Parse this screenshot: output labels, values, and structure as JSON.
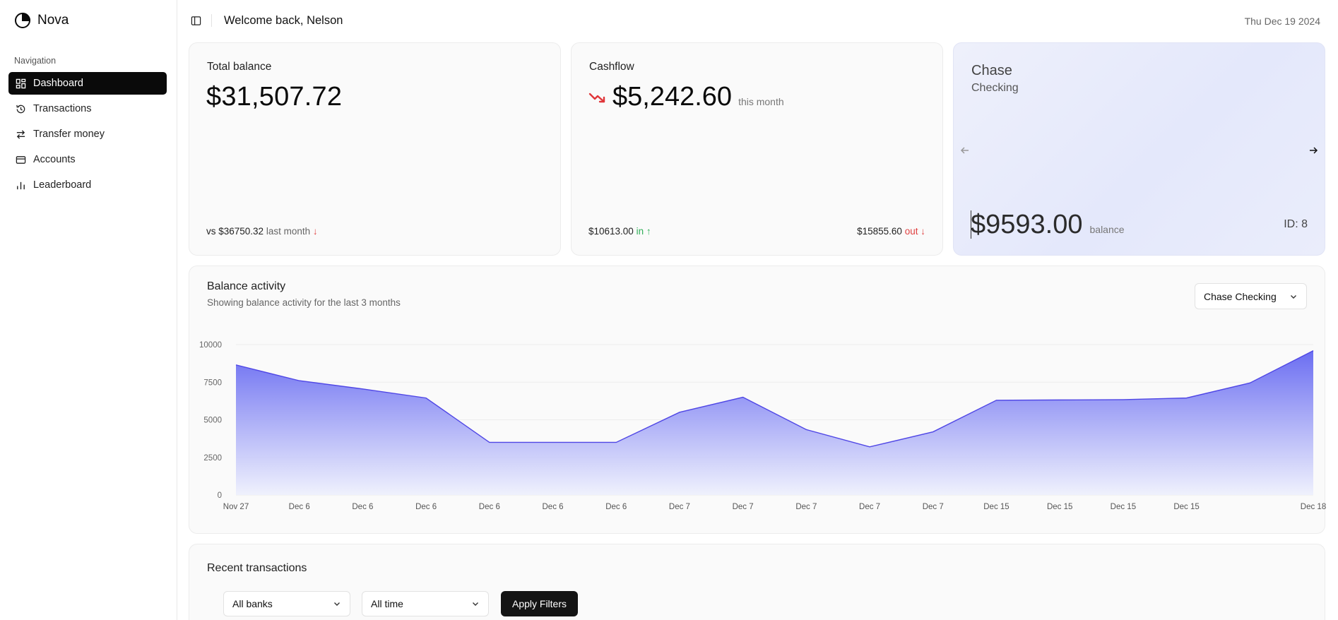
{
  "brand": {
    "name": "Nova",
    "icon": "pie-chart-icon"
  },
  "sidebar": {
    "heading": "Navigation",
    "items": [
      {
        "label": "Dashboard",
        "icon": "grid-icon",
        "active": true
      },
      {
        "label": "Transactions",
        "icon": "history-icon",
        "active": false
      },
      {
        "label": "Transfer money",
        "icon": "swap-arrows-icon",
        "active": false
      },
      {
        "label": "Accounts",
        "icon": "credit-card-icon",
        "active": false
      },
      {
        "label": "Leaderboard",
        "icon": "bar-chart-icon",
        "active": false
      }
    ]
  },
  "header": {
    "welcome": "Welcome back, Nelson",
    "date": "Thu Dec 19 2024"
  },
  "total_balance": {
    "label": "Total balance",
    "value": "$31,507.72",
    "compare_amount": "vs $36750.32",
    "compare_text": "last month",
    "trend": "↓"
  },
  "cashflow": {
    "label": "Cashflow",
    "value": "$5,242.60",
    "period": "this month",
    "in_amount": "$10613.00",
    "in_label": "in ↑",
    "out_amount": "$15855.60",
    "out_label": "out ↓"
  },
  "account_card": {
    "bank": "Chase",
    "type": "Checking",
    "balance": "$9593.00",
    "balance_label": "balance",
    "id_text": "ID: 8"
  },
  "balance_activity": {
    "title": "Balance activity",
    "subtitle": "Showing balance activity for the last 3 months",
    "account_select": "Chase Checking"
  },
  "chart_data": {
    "type": "area",
    "title": "Balance activity",
    "x": [
      "Nov 27",
      "Dec 6",
      "Dec 6",
      "Dec 6",
      "Dec 6",
      "Dec 6",
      "Dec 6",
      "Dec 7",
      "Dec 7",
      "Dec 7",
      "Dec 7",
      "Dec 7",
      "Dec 15",
      "Dec 15",
      "Dec 15",
      "Dec 15",
      "",
      "Dec 18"
    ],
    "values": [
      8650,
      7600,
      7050,
      6450,
      3500,
      3500,
      3500,
      5500,
      6500,
      4350,
      3200,
      4200,
      6300,
      6320,
      6340,
      6450,
      7450,
      9593
    ],
    "yticks": [
      0,
      2500,
      5000,
      7500,
      10000
    ],
    "ylim": [
      0,
      10000
    ],
    "grid": true,
    "colors": {
      "line": "#4f46e5",
      "fill_top": "#6366f1",
      "fill_bottom": "#eef0fd"
    }
  },
  "recent_transactions": {
    "title": "Recent transactions",
    "bank_filter": "All banks",
    "time_filter": "All time",
    "apply_label": "Apply Filters"
  }
}
